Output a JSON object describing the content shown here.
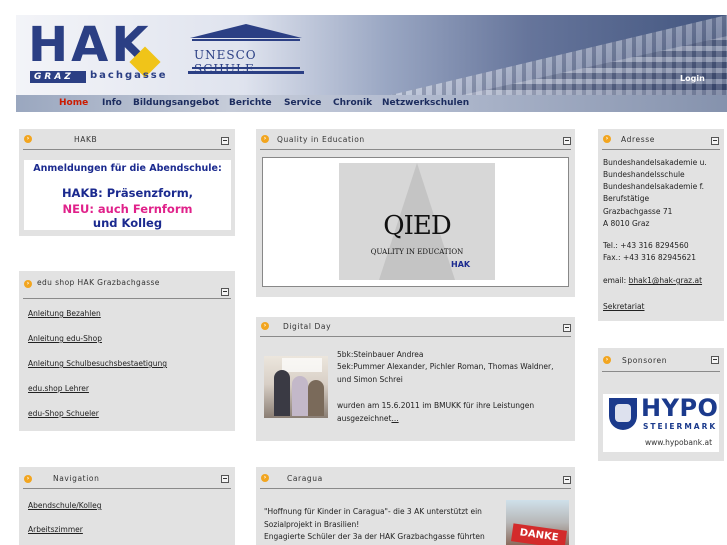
{
  "header": {
    "logo_text": "HAK",
    "logo_graz": "GRAZ",
    "logo_sub": "bachgasse",
    "unesco_text": "UNESCO SCHULE",
    "login_label": "Login"
  },
  "nav": {
    "items": [
      "Home",
      "Info",
      "Bildungsangebot",
      "Berichte",
      "Service",
      "Chronik",
      "Netzwerkschulen"
    ]
  },
  "left": {
    "hakb": {
      "title": "HAKB",
      "banner_line1": "Anmeldungen für die Abendschule:",
      "banner_line2": "HAKB: Präsenzform,",
      "banner_line3": "NEU: auch Fernform",
      "banner_line4": "und Kolleg"
    },
    "edushop": {
      "title": "edu shop HAK Grazbachgasse",
      "links": [
        "Anleitung Bezahlen",
        "Anleitung edu-Shop",
        "Anleitung Schulbesuchsbestaetigung",
        "edu.shop Lehrer",
        "edu-Shop Schueler"
      ]
    },
    "navigation": {
      "title": "Navigation",
      "links": [
        "Abendschule/Kolleg",
        "Arbeitszimmer"
      ]
    }
  },
  "center": {
    "quality": {
      "title": "Quality in Education",
      "logo_big": "QIED",
      "logo_small": "QUALITY IN EDUCATION",
      "logo_hak": "HAK"
    },
    "digital": {
      "title": "Digital Day",
      "line1": "5bk:Steinbauer Andrea",
      "line2": "5ek:Pummer Alexander, Pichler Roman, Thomas Waldner,",
      "line3": "und Simon Schrei",
      "line4": "wurden am 15.6.2011 im BMUKK für ihre Leistungen",
      "line5": "ausgezeichnet",
      "more": "..."
    },
    "caragua": {
      "title": "Caragua",
      "line1": "\"Hoffnung für Kinder in Caragua\"- die 3 AK unterstützt ein",
      "line2": "Sozialprojekt in Brasilien!",
      "line3": "Engagierte Schüler der 3a der HAK Grazbachgasse führten",
      "image_text": "DANKE"
    }
  },
  "right": {
    "adresse": {
      "title": "Adresse",
      "lines": [
        "Bundeshandelsakademie u.",
        "Bundeshandelsschule",
        "Bundeshandelsakademie f.",
        "Berufstätige",
        "Grazbachgasse 71",
        "A 8010 Graz"
      ],
      "tel": "Tel.: +43 316 8294560",
      "fax": "Fax.: +43 316 82945621",
      "email_label": "email:",
      "email": "bhak1@hak-graz.at",
      "sekretariat": "Sekretariat"
    },
    "sponsoren": {
      "title": "Sponsoren",
      "hypo_word": "HYPO",
      "hypo_sub": "STEIERMARK",
      "hypo_url": "www.hypobank.at"
    }
  },
  "colors": {
    "brand_blue": "#2b3f84",
    "nav_active": "#cc1b00",
    "box_bg": "#e2e2e2",
    "arrow": "#f2a51f"
  }
}
